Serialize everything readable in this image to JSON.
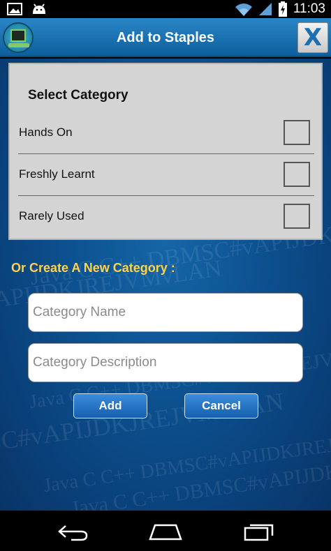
{
  "status_bar": {
    "time": "11:03"
  },
  "title_bar": {
    "title": "Add to Staples",
    "close_label": "X"
  },
  "category_panel": {
    "heading": "Select Category",
    "items": [
      {
        "label": "Hands On",
        "checked": false
      },
      {
        "label": "Freshly Learnt",
        "checked": false
      },
      {
        "label": "Rarely Used",
        "checked": false
      }
    ]
  },
  "create": {
    "heading": "Or Create A New Category :",
    "name_placeholder": "Category Name",
    "name_value": "",
    "description_placeholder": "Category Description",
    "description_value": ""
  },
  "buttons": {
    "add_label": "Add",
    "cancel_label": "Cancel"
  },
  "background_text": [
    "Java C C++ DBMSC#vAPIJDKJREJVMvLAN",
    "APIJDKJREJVMvLAN",
    "Java C C++ DBMSC#vAPIJDKJREJVM",
    "SC#vAPIJDKJREJVMvLAN",
    "Java C C++ DBMSC#vAPIJDKJREJVMvLAN",
    "Java C C++ DBMSC#vAPIJDKJR"
  ],
  "colors": {
    "title_bar": "#1a72b5",
    "accent_text": "#ffd24a",
    "button": "#2a78c8"
  }
}
